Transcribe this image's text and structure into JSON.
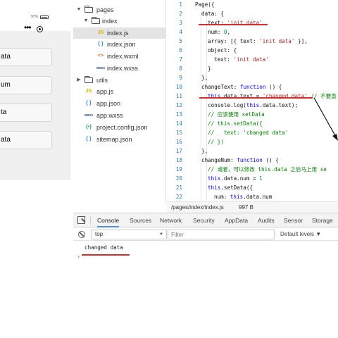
{
  "simulator": {
    "battery_text": "97%",
    "menu_icon": "more-dots-icon",
    "close_icon": "target-circle-icon",
    "buttons": [
      "ata",
      "um",
      "ta",
      "ata"
    ]
  },
  "file_tree": [
    {
      "name": "pages",
      "type": "folder",
      "expanded": true,
      "depth": 0
    },
    {
      "name": "index",
      "type": "folder",
      "expanded": true,
      "depth": 1
    },
    {
      "name": "index.js",
      "type": "js",
      "depth": 2,
      "selected": true,
      "icon_text": "JS"
    },
    {
      "name": "index.json",
      "type": "json",
      "depth": 2,
      "icon_text": "{ }"
    },
    {
      "name": "index.wxml",
      "type": "wxml",
      "depth": 2,
      "icon_text": "<>"
    },
    {
      "name": "index.wxss",
      "type": "wxss",
      "depth": 2,
      "icon_text": "wxss"
    },
    {
      "name": "utils",
      "type": "folder",
      "expanded": false,
      "depth": 0
    },
    {
      "name": "app.js",
      "type": "js",
      "depth": 0,
      "icon_text": "JS"
    },
    {
      "name": "app.json",
      "type": "json",
      "depth": 0,
      "icon_text": "{ }"
    },
    {
      "name": "app.wxss",
      "type": "wxss",
      "depth": 0,
      "icon_text": "wxss"
    },
    {
      "name": "project.config.json",
      "type": "cfg",
      "depth": 0,
      "icon_text": "{•}"
    },
    {
      "name": "sitemap.json",
      "type": "json",
      "depth": 0,
      "icon_text": "{ }"
    }
  ],
  "editor": {
    "lines": [
      {
        "num": "1",
        "indent": 0,
        "parts": [
          [
            "p",
            "Page({"
          ]
        ]
      },
      {
        "num": "2",
        "indent": 1,
        "parts": [
          [
            "p",
            "data: {"
          ]
        ]
      },
      {
        "num": "3",
        "indent": 2,
        "parts": [
          [
            "p",
            "text: "
          ],
          [
            "s",
            "'init data'"
          ],
          [
            "p",
            ","
          ]
        ]
      },
      {
        "num": "4",
        "indent": 2,
        "parts": [
          [
            "p",
            "num: "
          ],
          [
            "n",
            "0"
          ],
          [
            "p",
            ","
          ]
        ]
      },
      {
        "num": "5",
        "indent": 2,
        "parts": [
          [
            "p",
            "array: [{ text: "
          ],
          [
            "s",
            "'init data'"
          ],
          [
            "p",
            " }],"
          ]
        ]
      },
      {
        "num": "6",
        "indent": 2,
        "parts": [
          [
            "p",
            "object: {"
          ]
        ]
      },
      {
        "num": "7",
        "indent": 3,
        "parts": [
          [
            "p",
            "text: "
          ],
          [
            "s",
            "'init data'"
          ]
        ]
      },
      {
        "num": "8",
        "indent": 2,
        "parts": [
          [
            "p",
            "}"
          ]
        ]
      },
      {
        "num": "9",
        "indent": 1,
        "parts": [
          [
            "p",
            "},"
          ]
        ]
      },
      {
        "num": "10",
        "indent": 1,
        "parts": [
          [
            "p",
            "changeText: "
          ],
          [
            "k",
            "function"
          ],
          [
            "p",
            " () {"
          ]
        ]
      },
      {
        "num": "11",
        "indent": 2,
        "parts": [
          [
            "k",
            "this"
          ],
          [
            "p",
            ".data.text = "
          ],
          [
            "s",
            "'changed data'"
          ],
          [
            "c",
            " // 不要直"
          ]
        ]
      },
      {
        "num": "12",
        "indent": 2,
        "parts": [
          [
            "p",
            "console.log("
          ],
          [
            "k",
            "this"
          ],
          [
            "p",
            ".data.text);"
          ]
        ]
      },
      {
        "num": "13",
        "indent": 2,
        "parts": [
          [
            "c",
            "// 应该使用 setData"
          ]
        ]
      },
      {
        "num": "14",
        "indent": 2,
        "parts": [
          [
            "c",
            "// this.setData({"
          ]
        ]
      },
      {
        "num": "15",
        "indent": 2,
        "parts": [
          [
            "c",
            "//   text: 'changed data'"
          ]
        ]
      },
      {
        "num": "16",
        "indent": 2,
        "parts": [
          [
            "c",
            "// })"
          ]
        ]
      },
      {
        "num": "17",
        "indent": 1,
        "parts": [
          [
            "p",
            "},"
          ]
        ]
      },
      {
        "num": "18",
        "indent": 1,
        "parts": [
          [
            "p",
            "changeNum: "
          ],
          [
            "k",
            "function"
          ],
          [
            "p",
            " () {"
          ]
        ]
      },
      {
        "num": "19",
        "indent": 2,
        "parts": [
          [
            "c",
            "// 或者，可以修改 this.data 之后马上用 se"
          ]
        ]
      },
      {
        "num": "20",
        "indent": 2,
        "parts": [
          [
            "k",
            "this"
          ],
          [
            "p",
            ".data.num = "
          ],
          [
            "n",
            "1"
          ]
        ]
      },
      {
        "num": "21",
        "indent": 2,
        "parts": [
          [
            "k",
            "this"
          ],
          [
            "p",
            ".setData({"
          ]
        ]
      },
      {
        "num": "22",
        "indent": 3,
        "parts": [
          [
            "p",
            "num: "
          ],
          [
            "k",
            "this"
          ],
          [
            "p",
            ".data.num"
          ]
        ]
      }
    ],
    "status_path": "/pages/index/index.js",
    "status_size": "997 B"
  },
  "devtools": {
    "tabs": [
      "Console",
      "Sources",
      "Network",
      "Security",
      "AppData",
      "Audits",
      "Sensor",
      "Storage"
    ],
    "active_tab": "Console",
    "context": "top",
    "filter_placeholder": "Filter",
    "levels": "Default levels ▼",
    "log_output": "changed data",
    "prompt": "›"
  },
  "colors": {
    "annotation": "#d32f2f",
    "keyword": "#0000ff",
    "string": "#b22222",
    "comment": "#008000",
    "line_number": "#2a7ab0",
    "active_tab_underline": "#4a8ee6"
  }
}
